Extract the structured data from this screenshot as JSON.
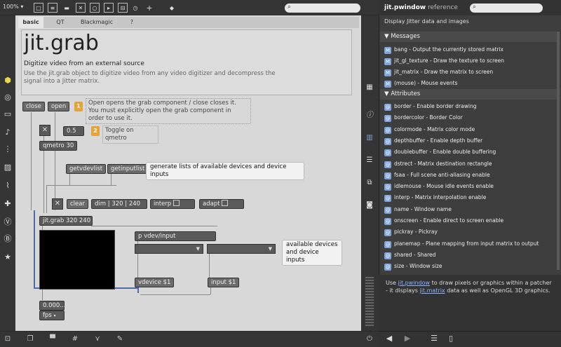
{
  "toolbar": {
    "zoom": "100%",
    "zoom_arrow": "▾"
  },
  "tabs": [
    "basic",
    "QT",
    "Blackmagic",
    "?"
  ],
  "title": "jit.grab",
  "subtitle": "Digitize video from an external source",
  "description": "Use the jit.grab object to digitize video from any video digitizer and decompress the signal into a Jitter matrix.",
  "patch": {
    "close_msg": "close",
    "open_msg": "open",
    "step1_num": "1",
    "step1_text": "Open opens the grab component / close closes it. You must explicitly open the grab component in order to use it.",
    "num_05": "0.5",
    "step2_num": "2",
    "step2_text": "Toggle on qmetro",
    "qmetro": "qmetro 30",
    "getvdevlist": "getvdevlist",
    "getinputlist": "getinputlist",
    "lists_comment": "generate lists of available devices and device inputs",
    "clear_msg": "clear",
    "dim_msg": "dim",
    "dim_w": "320",
    "dim_h": "240",
    "interp_msg": "interp",
    "adapt_msg": "adapt",
    "jitgrab": "jit.grab 320 240",
    "pvdevinput": "p vdev/input",
    "available_comment": "available devices and device inputs",
    "vdevice_msg": "vdevice $1",
    "input_msg": "input $1",
    "fps_value": "0.000...",
    "fps_label": "fps"
  },
  "reference": {
    "title": "jit.pwindow",
    "title_suffix": "reference",
    "description": "Display Jitter data and images",
    "messages_header": "Messages",
    "messages": [
      "bang - Output the currently stored matrix",
      "jit_gl_texture - Draw the texture to screen",
      "jit_matrix - Draw the matrix to screen",
      "(mouse) - Mouse events"
    ],
    "attributes_header": "Attributes",
    "attributes": [
      "border - Enable border drawing",
      "bordercolor - Border Color",
      "colormode - Matrix color mode",
      "depthbuffer - Enable depth buffer",
      "doublebuffer - Enable double buffering",
      "dstrect - Matrix destination rectangle",
      "fsaa - Full scene anti-aliasing enable",
      "idlemouse - Mouse idle events enable",
      "interp - Matrix interpolation enable",
      "name - Window name",
      "onscreen - Enable direct to screen enable",
      "pickray - Pickray",
      "planemap - Plane mapping from input matrix to output",
      "shared - Shared",
      "size - Window size"
    ],
    "footer_use": "Use",
    "footer_link1": "jit.pwindow",
    "footer_mid": "to draw pixels or graphics within a patcher - it displays",
    "footer_link2": "jit.matrix",
    "footer_end": "data as well as OpenGL 3D graphics."
  },
  "colors": {
    "accent_orange": "#e8a23a",
    "link_blue": "#8cb4ff",
    "cable_blue": "#4a6ea8"
  }
}
